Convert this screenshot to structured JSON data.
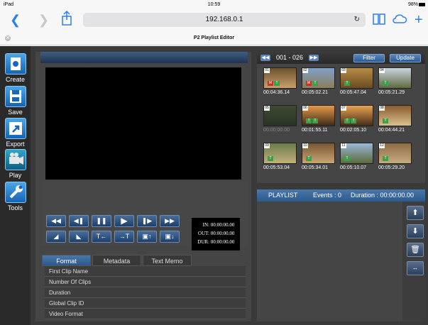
{
  "status": {
    "device": "iPad",
    "time": "10:59",
    "battery": "98%"
  },
  "browser": {
    "url": "192.168.0.1",
    "page_title": "P2 Playlist Editor"
  },
  "sidebar": {
    "items": [
      {
        "label": "Create",
        "icon": "create-icon"
      },
      {
        "label": "Save",
        "icon": "save-icon"
      },
      {
        "label": "Export",
        "icon": "export-icon"
      },
      {
        "label": "Play",
        "icon": "play-icon"
      },
      {
        "label": "Tools",
        "icon": "tools-icon"
      }
    ]
  },
  "timecode": {
    "in_label": "IN:",
    "in": "00:00:00.00",
    "out_label": "OUT:",
    "out": "00:00:00.00",
    "dur_label": "DUR:",
    "dur": "00:00:00.00"
  },
  "tabs": [
    "Format",
    "Metadata",
    "Text Memo"
  ],
  "properties": [
    "First Clip Name",
    "Number Of Clips",
    "Duration",
    "Global Clip ID",
    "Video Format"
  ],
  "thumbs": {
    "range": "001 - 026",
    "filter": "Filter",
    "update": "Update",
    "clips": [
      {
        "num": "01",
        "dur": "00:04:36.14",
        "badges": [
          "M",
          "T"
        ],
        "colors": [
          "#6d5030",
          "#c7a06a"
        ]
      },
      {
        "num": "02",
        "dur": "00:05:02.21",
        "badges": [
          "M",
          "T"
        ],
        "colors": [
          "#7fa0c8",
          "#8d7d5c"
        ]
      },
      {
        "num": "03",
        "dur": "00:05:47.04",
        "badges": [
          "T"
        ],
        "colors": [
          "#b58b45",
          "#6b4c22"
        ]
      },
      {
        "num": "04",
        "dur": "00:05:21.29",
        "badges": [
          "T"
        ],
        "colors": [
          "#c9d4e0",
          "#5f6a3e"
        ]
      },
      {
        "num": "05",
        "dur": "00:00:00.00",
        "badges": [],
        "colors": [
          "#3e4a33",
          "#2b3326"
        ]
      },
      {
        "num": "06",
        "dur": "00:01:55.11",
        "badges": [
          "T",
          "T"
        ],
        "colors": [
          "#e59a48",
          "#3d2b1a"
        ]
      },
      {
        "num": "07",
        "dur": "00:02:05.10",
        "badges": [
          "T",
          "T"
        ],
        "colors": [
          "#e8a352",
          "#442d18"
        ]
      },
      {
        "num": "08",
        "dur": "00:04:44.21",
        "badges": [
          "T"
        ],
        "colors": [
          "#8a5c2e",
          "#d9c08f"
        ]
      },
      {
        "num": "09",
        "dur": "00:05:53.04",
        "badges": [
          "T"
        ],
        "colors": [
          "#6a7b4a",
          "#c2b07a"
        ]
      },
      {
        "num": "10",
        "dur": "00:05:34.01",
        "badges": [
          "T"
        ],
        "colors": [
          "#7a5634",
          "#c9a574"
        ]
      },
      {
        "num": "11",
        "dur": "00:05:10.07",
        "badges": [
          "T"
        ],
        "colors": [
          "#9ab7d8",
          "#5c6b3a"
        ]
      },
      {
        "num": "12",
        "dur": "00:05:29.20",
        "badges": [
          "T"
        ],
        "colors": [
          "#8d6b45",
          "#c6ab7f"
        ]
      }
    ]
  },
  "playlist": {
    "title": "PLAYLIST",
    "events": "Events : 0",
    "duration": "Duration :  00:00:00.00"
  }
}
